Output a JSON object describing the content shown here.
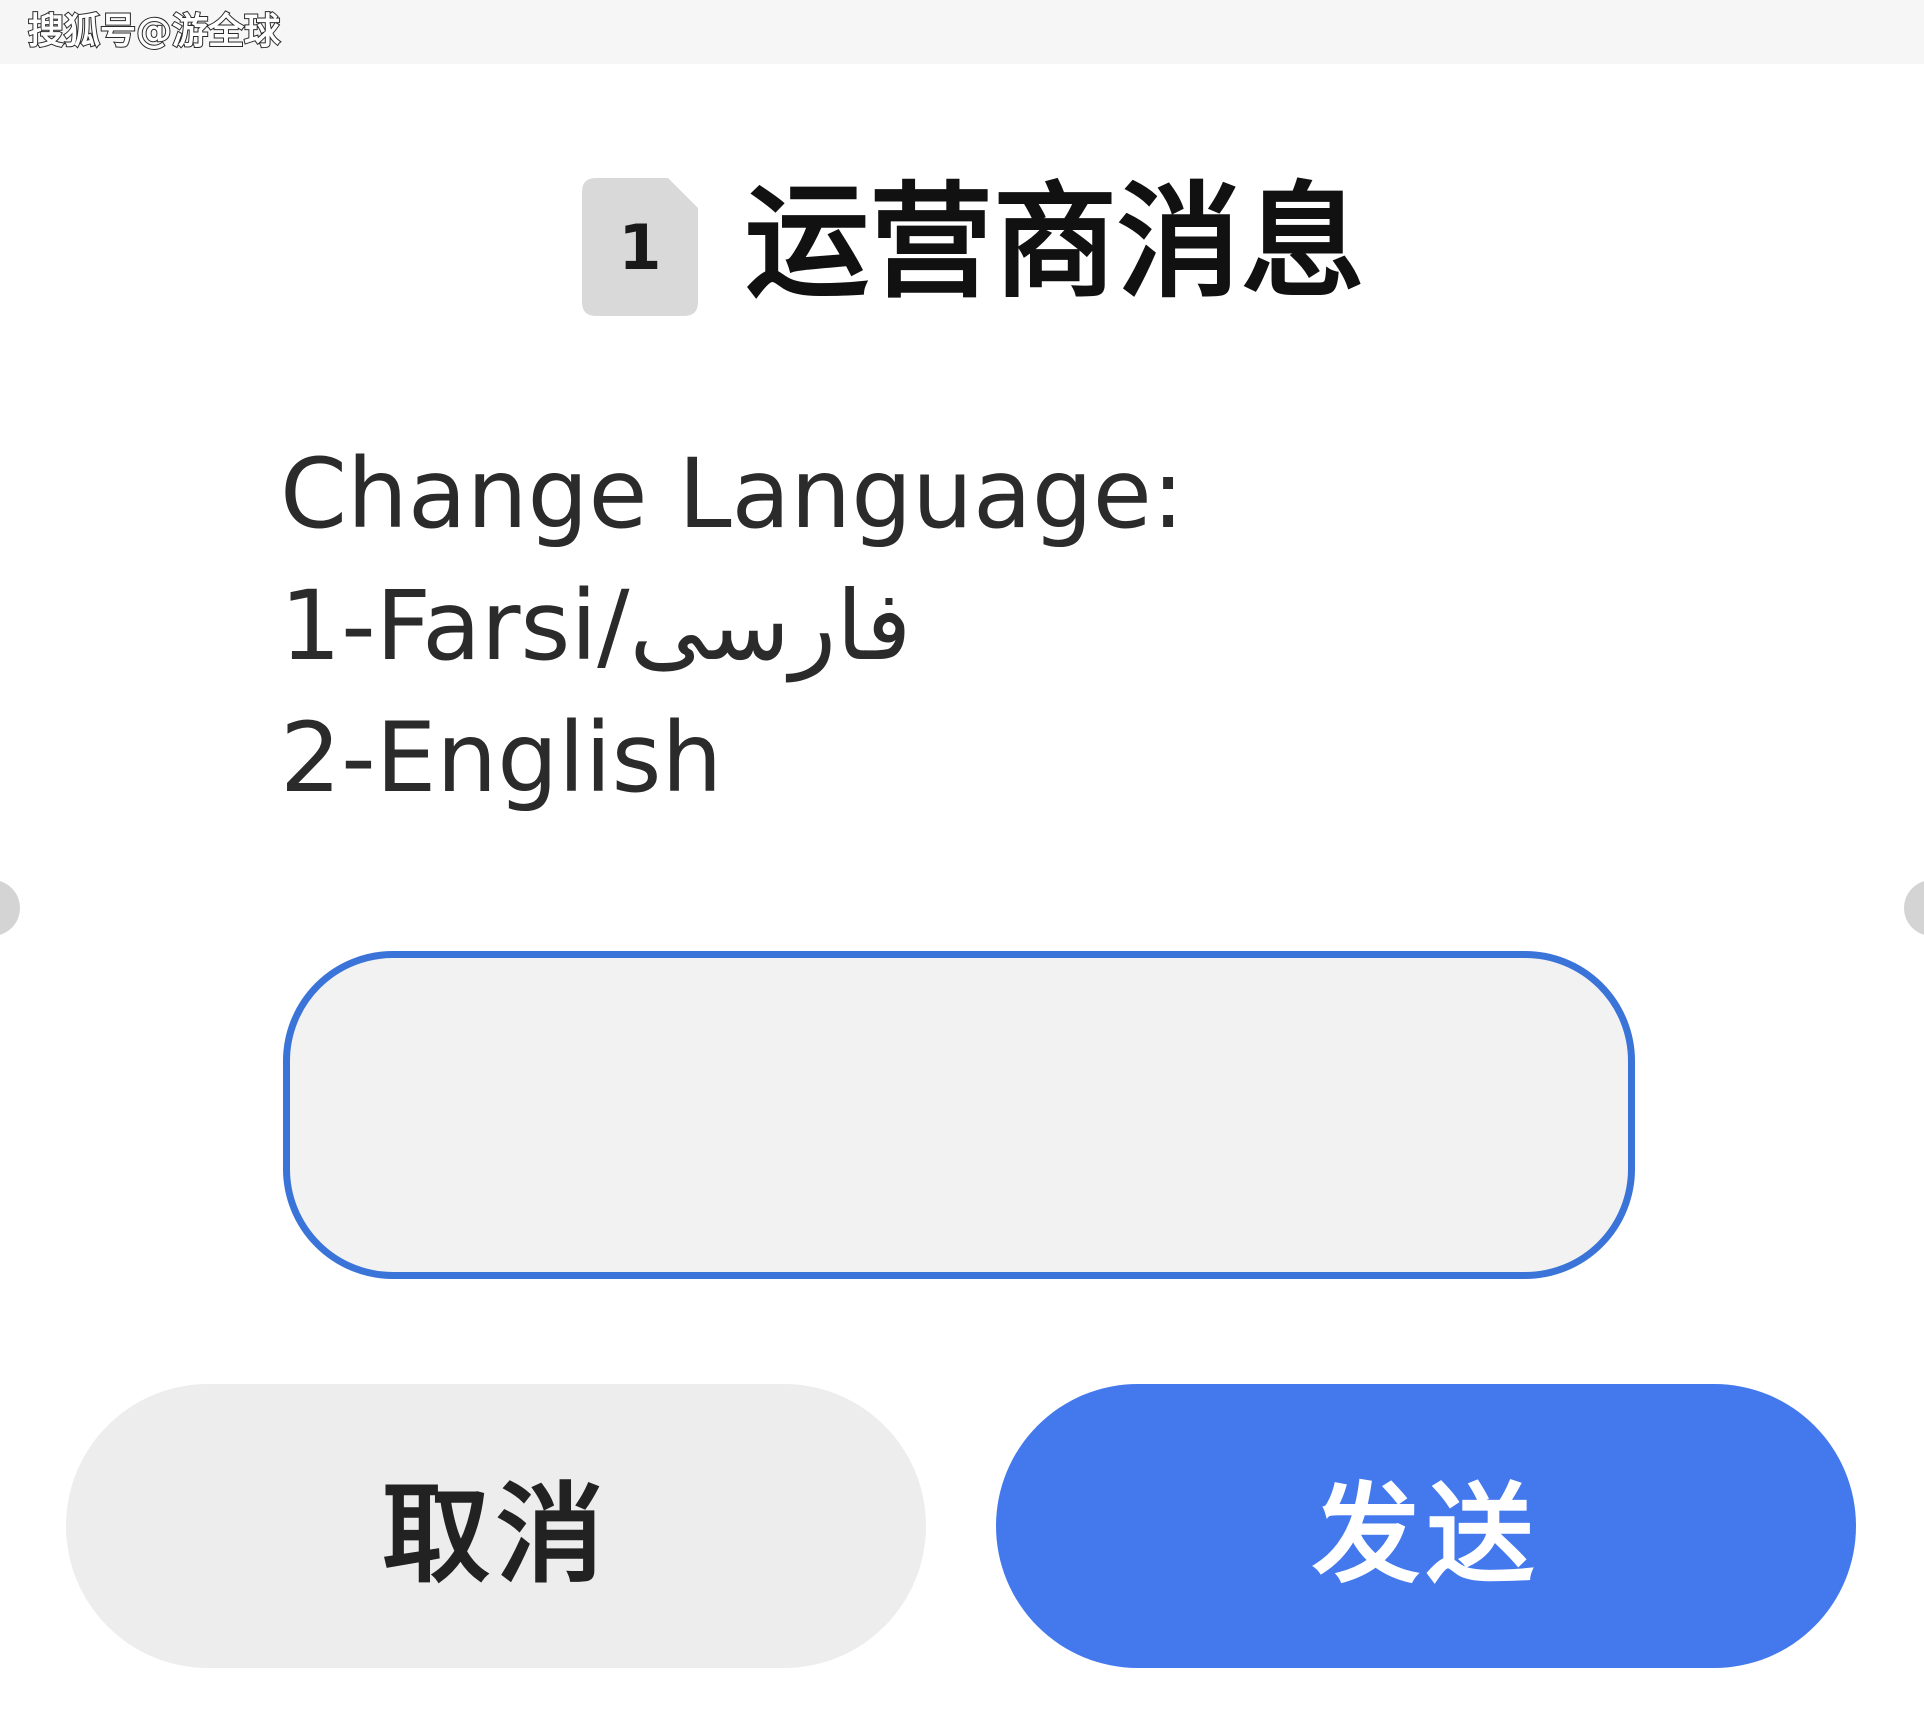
{
  "watermark": {
    "text": "搜狐号@游全球"
  },
  "dialog": {
    "sim_slot": "1",
    "title": "运营商消息",
    "message_lines": [
      "Change Language:",
      "1-Farsi/فارسی",
      "2-English"
    ],
    "reply_input": {
      "value": "",
      "placeholder": ""
    },
    "buttons": {
      "cancel_label": "取消",
      "send_label": "发送"
    }
  },
  "colors": {
    "accent": "#4479ee",
    "input_border": "#3b74d8",
    "cancel_bg": "#ededed",
    "sim_icon_bg": "#d9d9d9"
  },
  "icons": {
    "sim": "sim-card-icon"
  }
}
